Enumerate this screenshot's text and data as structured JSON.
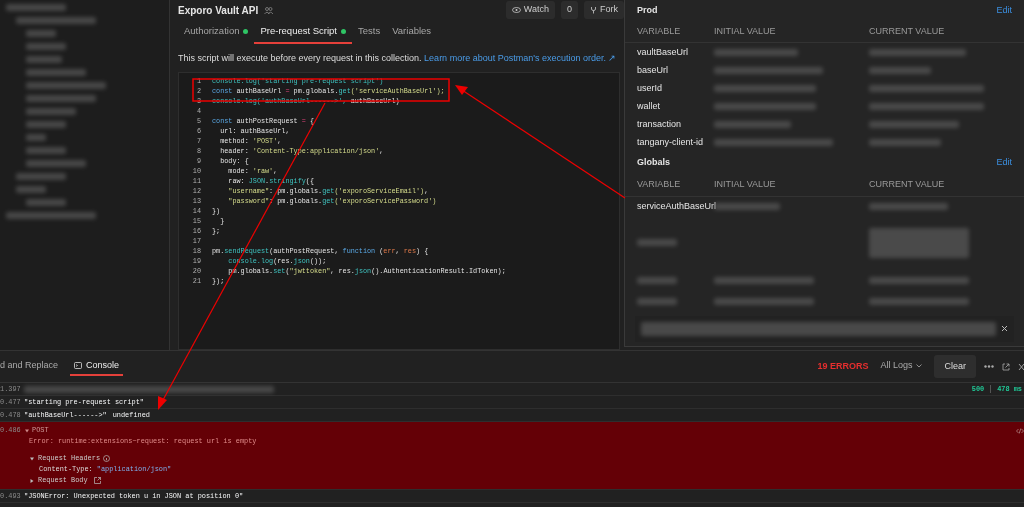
{
  "header": {
    "title": "Exporo Vault API",
    "watch_label": "Watch",
    "watch_count": "0",
    "fork_label": "Fork"
  },
  "tabs": [
    {
      "label": "Authorization",
      "selected": false,
      "dot": true
    },
    {
      "label": "Pre-request Script",
      "selected": true,
      "dot": true
    },
    {
      "label": "Tests",
      "selected": false,
      "dot": false
    },
    {
      "label": "Variables",
      "selected": false,
      "dot": false
    }
  ],
  "info": {
    "text": "This script will execute before every request in this collection.",
    "link": "Learn more about Postman's execution order. ↗"
  },
  "editor": {
    "lines": [
      {
        "number": "1",
        "tokens": [
          {
            "text": "console.log('starting pre-request script')",
            "kind": "function"
          }
        ]
      },
      {
        "number": "2",
        "tokens": [
          {
            "text": "const",
            "kind": "keyword"
          },
          {
            "text": " authBaseUrl ",
            "kind": "plain"
          },
          {
            "text": "=",
            "kind": "operator"
          },
          {
            "text": " pm.globals.",
            "kind": "plain"
          },
          {
            "text": "get",
            "kind": "function"
          },
          {
            "text": "('serviceAuthBaseUrl');",
            "kind": "string"
          }
        ]
      },
      {
        "number": "3",
        "tokens": [
          {
            "text": "console.log('authBaseUrl------>', ",
            "kind": "function"
          },
          {
            "text": "authBaseUrl)",
            "kind": "plain"
          }
        ]
      },
      {
        "number": "4"
      },
      {
        "number": "5",
        "tokens": [
          {
            "text": "const",
            "kind": "keyword"
          },
          {
            "text": " authPostRequest ",
            "kind": "plain"
          },
          {
            "text": "=",
            "kind": "operator"
          },
          {
            "text": " {",
            "kind": "plain"
          }
        ]
      },
      {
        "number": "6",
        "tokens": [
          {
            "text": "  url: authBaseUrl,",
            "kind": "plain"
          }
        ]
      },
      {
        "number": "7",
        "tokens": [
          {
            "text": "  method: ",
            "kind": "plain"
          },
          {
            "text": "'POST'",
            "kind": "string"
          },
          {
            "text": ",",
            "kind": "plain"
          }
        ]
      },
      {
        "number": "8",
        "tokens": [
          {
            "text": "  header: ",
            "kind": "plain"
          },
          {
            "text": "'Content-Type:application/json'",
            "kind": "string"
          },
          {
            "text": ",",
            "kind": "plain"
          }
        ]
      },
      {
        "number": "9",
        "tokens": [
          {
            "text": "  body: {",
            "kind": "plain"
          }
        ]
      },
      {
        "number": "10",
        "tokens": [
          {
            "text": "    mode: ",
            "kind": "plain"
          },
          {
            "text": "'raw'",
            "kind": "string"
          },
          {
            "text": ",",
            "kind": "plain"
          }
        ]
      },
      {
        "number": "11",
        "tokens": [
          {
            "text": "    raw: ",
            "kind": "plain"
          },
          {
            "text": "JSON",
            "kind": "function"
          },
          {
            "text": ".",
            "kind": "plain"
          },
          {
            "text": "stringify",
            "kind": "function"
          },
          {
            "text": "({",
            "kind": "plain"
          }
        ]
      },
      {
        "number": "12",
        "tokens": [
          {
            "text": "    \"username\"",
            "kind": "string"
          },
          {
            "text": ": pm.globals.",
            "kind": "plain"
          },
          {
            "text": "get",
            "kind": "function"
          },
          {
            "text": "('exporoServiceEmail')",
            "kind": "string"
          },
          {
            "text": ",",
            "kind": "plain"
          }
        ]
      },
      {
        "number": "13",
        "tokens": [
          {
            "text": "    \"password\"",
            "kind": "string"
          },
          {
            "text": ": pm.globals.",
            "kind": "plain"
          },
          {
            "text": "get",
            "kind": "function"
          },
          {
            "text": "('exporoServicePassword')",
            "kind": "string"
          }
        ]
      },
      {
        "number": "14",
        "tokens": [
          {
            "text": "})",
            "kind": "plain"
          }
        ]
      },
      {
        "number": "15",
        "tokens": [
          {
            "text": "  }",
            "kind": "plain"
          }
        ]
      },
      {
        "number": "16",
        "tokens": [
          {
            "text": "};",
            "kind": "plain"
          }
        ]
      },
      {
        "number": "17"
      },
      {
        "number": "18",
        "tokens": [
          {
            "text": "pm.",
            "kind": "plain"
          },
          {
            "text": "sendRequest",
            "kind": "function"
          },
          {
            "text": "(authPostRequest, ",
            "kind": "plain"
          },
          {
            "text": "function",
            "kind": "keyword"
          },
          {
            "text": " (",
            "kind": "plain"
          },
          {
            "text": "err",
            "kind": "param"
          },
          {
            "text": ", ",
            "kind": "plain"
          },
          {
            "text": "res",
            "kind": "param"
          },
          {
            "text": ") {",
            "kind": "plain"
          }
        ]
      },
      {
        "number": "19",
        "tokens": [
          {
            "text": "    console.log",
            "kind": "function"
          },
          {
            "text": "(res.",
            "kind": "plain"
          },
          {
            "text": "json",
            "kind": "function"
          },
          {
            "text": "());",
            "kind": "plain"
          }
        ]
      },
      {
        "number": "20",
        "tokens": [
          {
            "text": "    pm.globals.",
            "kind": "plain"
          },
          {
            "text": "set",
            "kind": "function"
          },
          {
            "text": "(",
            "kind": "plain"
          },
          {
            "text": "\"jwttoken\"",
            "kind": "string"
          },
          {
            "text": ", res.",
            "kind": "plain"
          },
          {
            "text": "json",
            "kind": "function"
          },
          {
            "text": "().AuthenticationResult.IdToken);",
            "kind": "plain"
          }
        ]
      },
      {
        "number": "21",
        "tokens": [
          {
            "text": "});",
            "kind": "plain"
          }
        ]
      }
    ]
  },
  "environment_panel": {
    "sections": [
      {
        "title": "Prod",
        "edit": "Edit",
        "columns": [
          "VARIABLE",
          "INITIAL VALUE",
          "CURRENT VALUE"
        ],
        "rows": [
          {
            "variable": "vaultBaseUrl"
          },
          {
            "variable": "baseUrl"
          },
          {
            "variable": "userId"
          },
          {
            "variable": "wallet"
          },
          {
            "variable": "transaction"
          },
          {
            "variable": "tangany-client-id"
          }
        ]
      },
      {
        "title": "Globals",
        "edit": "Edit",
        "columns": [
          "VARIABLE",
          "INITIAL VALUE",
          "CURRENT VALUE"
        ],
        "rows": [
          {
            "variable": "serviceAuthBaseUrl"
          }
        ]
      }
    ]
  },
  "console": {
    "tabs": [
      {
        "label": "d and Replace",
        "selected": false
      },
      {
        "label": "Console",
        "selected": true
      }
    ],
    "error_count": "19 ERRORS",
    "filter": "All Logs",
    "clear": "Clear",
    "entries": [
      {
        "kind": "request",
        "time": "1.397",
        "status": "500",
        "duration": "478 ms"
      },
      {
        "kind": "log",
        "time": "0.477",
        "text": "\"starting pre-request script\""
      },
      {
        "kind": "log",
        "time": "0.478",
        "text": "\"authBaseUrl------>\"",
        "extra": "undefined"
      },
      {
        "kind": "error",
        "time": "0.486",
        "method": "POST",
        "expanded": true,
        "message": "Error: runtime:extensions~request: request url is empty",
        "headers_label": "Request Headers",
        "headers_expanded": true,
        "headers": [
          {
            "name": "Content-Type:",
            "value": "\"application/json\""
          }
        ],
        "body_label": "Request Body",
        "body_expanded": false
      },
      {
        "kind": "log",
        "time": "0.493",
        "text": "\"JSONError: Unexpected token u in JSON at position 0\""
      }
    ]
  }
}
